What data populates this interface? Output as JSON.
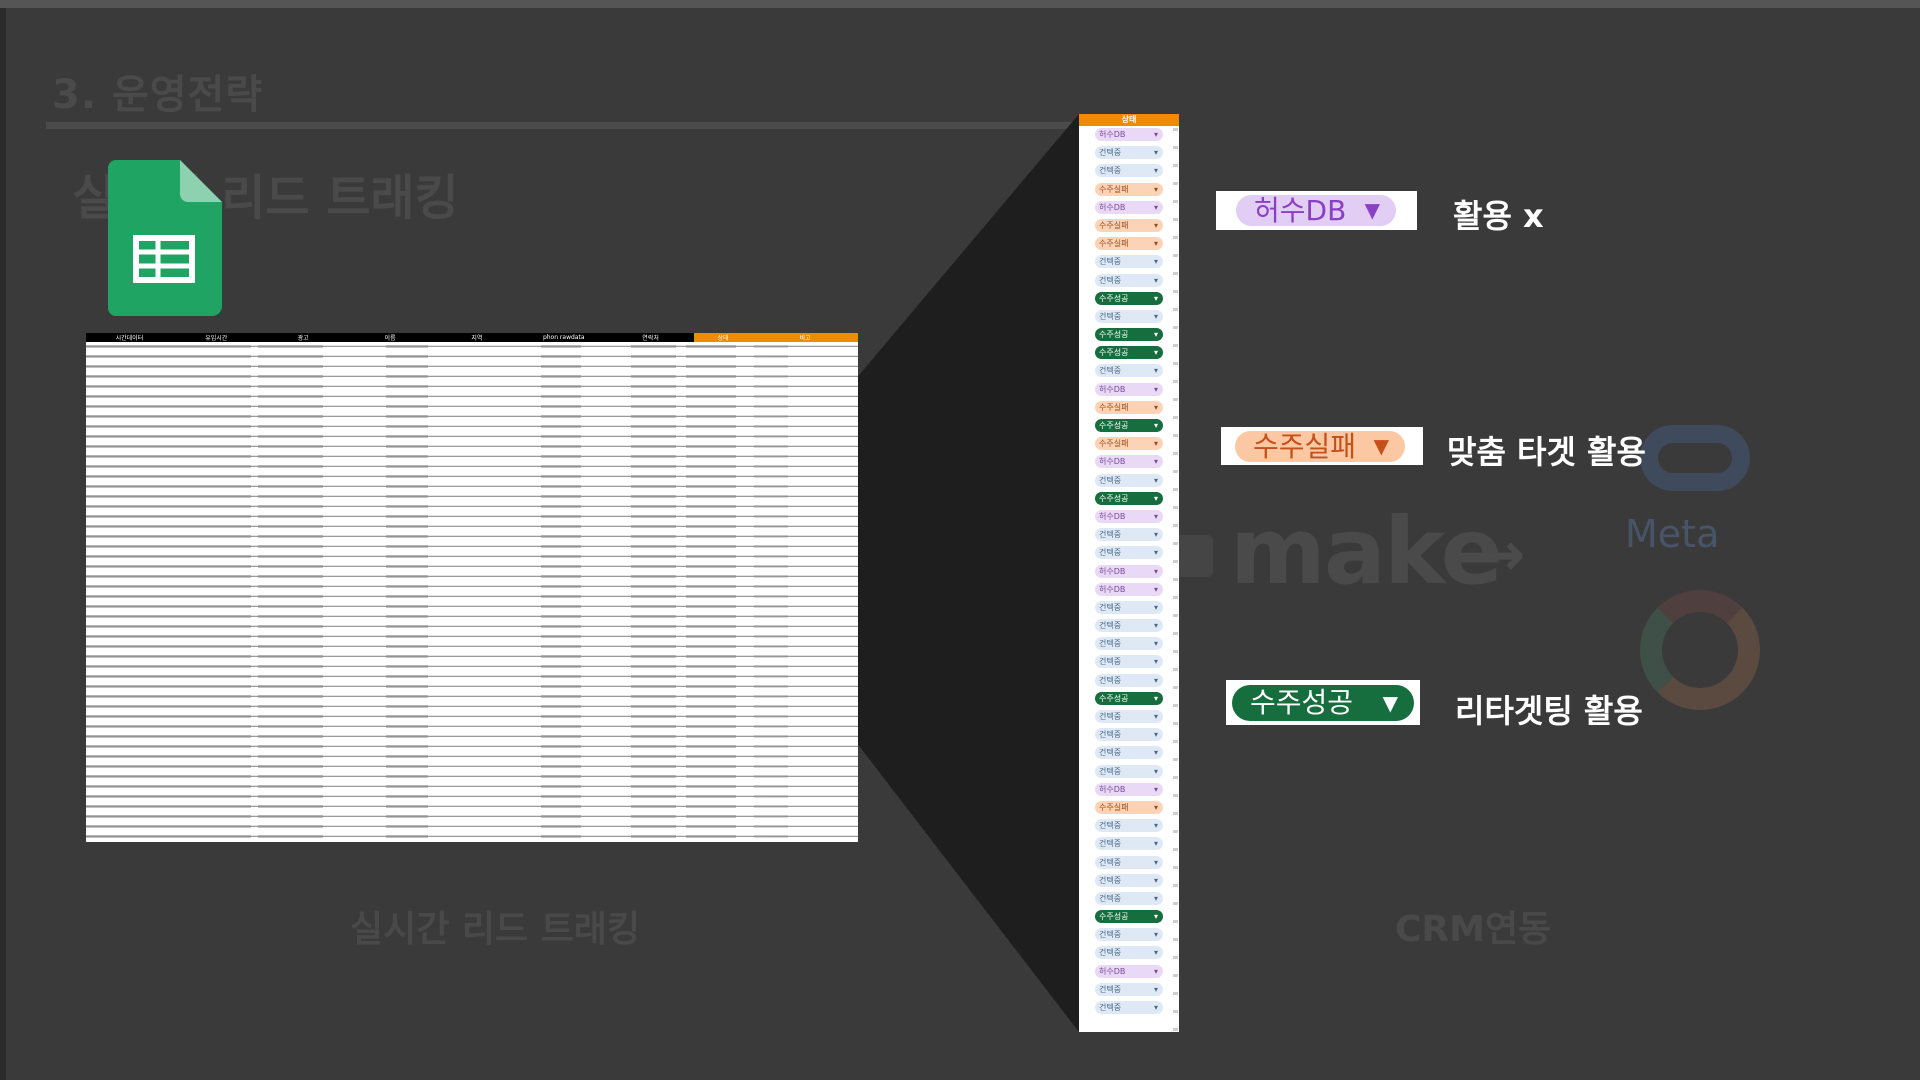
{
  "slide": {
    "section_title": "3. 운영전략",
    "subtitle": "실시간 리드 트래킹",
    "bottom_caption_left": "실시간 리드 트래킹",
    "bottom_caption_right": "CRM연동",
    "bg_make_logo": "make",
    "bg_meta_logo": "Meta"
  },
  "sheet": {
    "columns": [
      "시간데이터",
      "유입시간",
      "광고",
      "이름",
      "지역",
      "phon rawdata",
      "연락처",
      "상태",
      "비고"
    ],
    "status_header": "상태"
  },
  "status_column": {
    "header": "상태",
    "items": [
      "허수DB",
      "건텍중",
      "건텍중",
      "수주실패",
      "허수DB",
      "수주실패",
      "수주실패",
      "건텍중",
      "건텍중",
      "수주성공",
      "건텍중",
      "수주성공",
      "수주성공",
      "건텍중",
      "허수DB",
      "수주실패",
      "수주성공",
      "수주실패",
      "허수DB",
      "건텍중",
      "수주성공",
      "허수DB",
      "건텍중",
      "건텍중",
      "허수DB",
      "허수DB",
      "건텍중",
      "건텍중",
      "건텍중",
      "건텍중",
      "건텍중",
      "수주성공",
      "건텍중",
      "건텍중",
      "건텍중",
      "건텍중",
      "허수DB",
      "수주실패",
      "건텍중",
      "건텍중",
      "건텍중",
      "건텍중",
      "건텍중",
      "수주성공",
      "건텍중",
      "건텍중",
      "허수DB",
      "건텍중",
      "건텍중"
    ]
  },
  "legend": [
    {
      "chip": "허수DB",
      "label": "활용 x",
      "bg": "#e2cdf5",
      "fg": "#8a3fc4"
    },
    {
      "chip": "수주실패",
      "label": "맞춤 타겟 활용",
      "bg": "#fcc8a3",
      "fg": "#c4501a"
    },
    {
      "chip": "수주성공",
      "label": "리타겟팅 활용",
      "bg": "#166d3e",
      "fg": "#ffffff"
    }
  ]
}
